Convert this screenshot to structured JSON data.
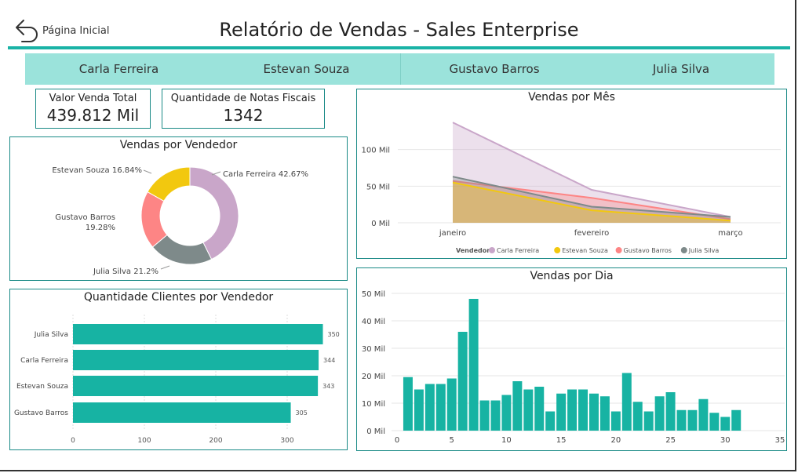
{
  "header": {
    "back_label": "Página Inicial",
    "title": "Relatório de Vendas - Sales Enterprise"
  },
  "slicer": {
    "items": [
      "Carla Ferreira",
      "Estevan Souza",
      "Gustavo Barros",
      "Julia Silva"
    ]
  },
  "cards": {
    "total": {
      "label": "Valor Venda Total",
      "value": "439.812 Mil"
    },
    "notas": {
      "label": "Quantidade de Notas Fiscais",
      "value": "1342"
    }
  },
  "colors": {
    "accent": "#1ab3a6",
    "slicer_bg": "#9be3db",
    "carla": "#c9a6c9",
    "estevan": "#f2c80f",
    "gustavo": "#fd8585",
    "julia": "#7e8a8a",
    "bar": "#17b3a3"
  },
  "charts": {
    "vendedor": {
      "title": "Vendas por Vendedor"
    },
    "clientes": {
      "title": "Quantidade Clientes por Vendedor"
    },
    "mes": {
      "title": "Vendas por Mês",
      "legend_title": "Vendedor"
    },
    "dia": {
      "title": "Vendas por Dia"
    }
  },
  "chart_data": [
    {
      "type": "pie",
      "title": "Vendas por Vendedor",
      "slices": [
        {
          "name": "Carla Ferreira",
          "value": 42.67,
          "label": "Carla Ferreira 42.67%"
        },
        {
          "name": "Julia Silva",
          "value": 21.2,
          "label": "Julia Silva 21.2%"
        },
        {
          "name": "Gustavo Barros",
          "value": 19.28,
          "label": "Gustavo Barros 19.28%"
        },
        {
          "name": "Estevan Souza",
          "value": 16.84,
          "label": "Estevan Souza 16.84%"
        }
      ]
    },
    {
      "type": "bar",
      "title": "Quantidade Clientes por Vendedor",
      "categories": [
        "Julia Silva",
        "Carla Ferreira",
        "Estevan Souza",
        "Gustavo Barros"
      ],
      "values": [
        350,
        344,
        343,
        305
      ],
      "xlim": [
        0,
        350
      ],
      "xticks": [
        "0",
        "100",
        "200",
        "300"
      ]
    },
    {
      "type": "area",
      "title": "Vendas por Mês",
      "categories": [
        "janeiro",
        "fevereiro",
        "março"
      ],
      "series": [
        {
          "name": "Carla Ferreira",
          "values": [
            137,
            45,
            8
          ]
        },
        {
          "name": "Estevan Souza",
          "values": [
            55,
            17,
            3
          ]
        },
        {
          "name": "Gustavo Barros",
          "values": [
            57,
            34,
            5
          ]
        },
        {
          "name": "Julia Silva",
          "values": [
            63,
            22,
            8
          ]
        }
      ],
      "ylim": [
        0,
        150
      ],
      "yticks": [
        "0 Mil",
        "50 Mil",
        "100 Mil"
      ],
      "legend_title": "Vendedor",
      "grid": true
    },
    {
      "type": "bar",
      "title": "Vendas por Dia",
      "x": [
        1,
        2,
        3,
        4,
        5,
        6,
        7,
        8,
        9,
        10,
        11,
        12,
        13,
        14,
        15,
        16,
        17,
        18,
        19,
        20,
        21,
        22,
        23,
        24,
        25,
        26,
        27,
        28,
        29,
        30,
        31
      ],
      "values": [
        19.5,
        15,
        17,
        17,
        19,
        36,
        48,
        11,
        11,
        13,
        18,
        15,
        16,
        7,
        13.5,
        15,
        15,
        13.5,
        12.5,
        7,
        21,
        10.5,
        7,
        12.5,
        14,
        7.5,
        7.5,
        11.5,
        6.5,
        5,
        7.5
      ],
      "ylim": [
        0,
        50
      ],
      "yticks": [
        "0 Mil",
        "10 Mil",
        "20 Mil",
        "30 Mil",
        "40 Mil",
        "50 Mil"
      ],
      "xlim": [
        0,
        35
      ],
      "xticks": [
        "0",
        "5",
        "10",
        "15",
        "20",
        "25",
        "30",
        "35"
      ],
      "grid": true
    }
  ]
}
